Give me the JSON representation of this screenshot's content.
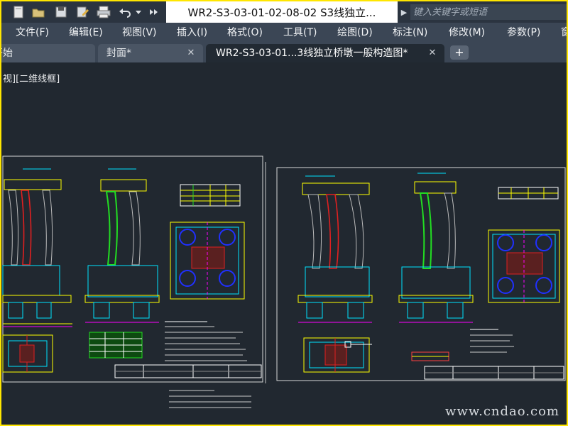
{
  "quick_access": {
    "buttons": [
      "new-icon",
      "open-icon",
      "save-icon",
      "saveas-icon",
      "print-icon",
      "undo-icon",
      "dropdown-icon",
      "more-icon"
    ]
  },
  "title": {
    "document_name": "WR2-S3-03-01-02-08-02 S3线独立..."
  },
  "search": {
    "placeholder": "键入关键字或短语"
  },
  "menubar": {
    "items": [
      "文件(F)",
      "编辑(E)",
      "视图(V)",
      "插入(I)",
      "格式(O)",
      "工具(T)",
      "绘图(D)",
      "标注(N)",
      "修改(M)",
      "参数(P)",
      "窗"
    ]
  },
  "tabs": {
    "items": [
      {
        "label": "开始",
        "active": false,
        "closable": false
      },
      {
        "label": "封面*",
        "active": false,
        "closable": true
      },
      {
        "label": "WR2-S3-03-01...3线独立桥墩一般构造图*",
        "active": true,
        "closable": true
      }
    ],
    "add_label": "+"
  },
  "viewport": {
    "view_label": "视][二维线框]",
    "background_color": "#212830"
  },
  "watermark": {
    "text": "www.cndao.com"
  },
  "colors": {
    "frame": "#ffe600",
    "accent_yellow": "#ffff00",
    "accent_cyan": "#00e5ff",
    "accent_green": "#22dd22",
    "accent_red": "#e02020",
    "accent_blue": "#2030ff",
    "accent_magenta": "#ff00ff"
  }
}
